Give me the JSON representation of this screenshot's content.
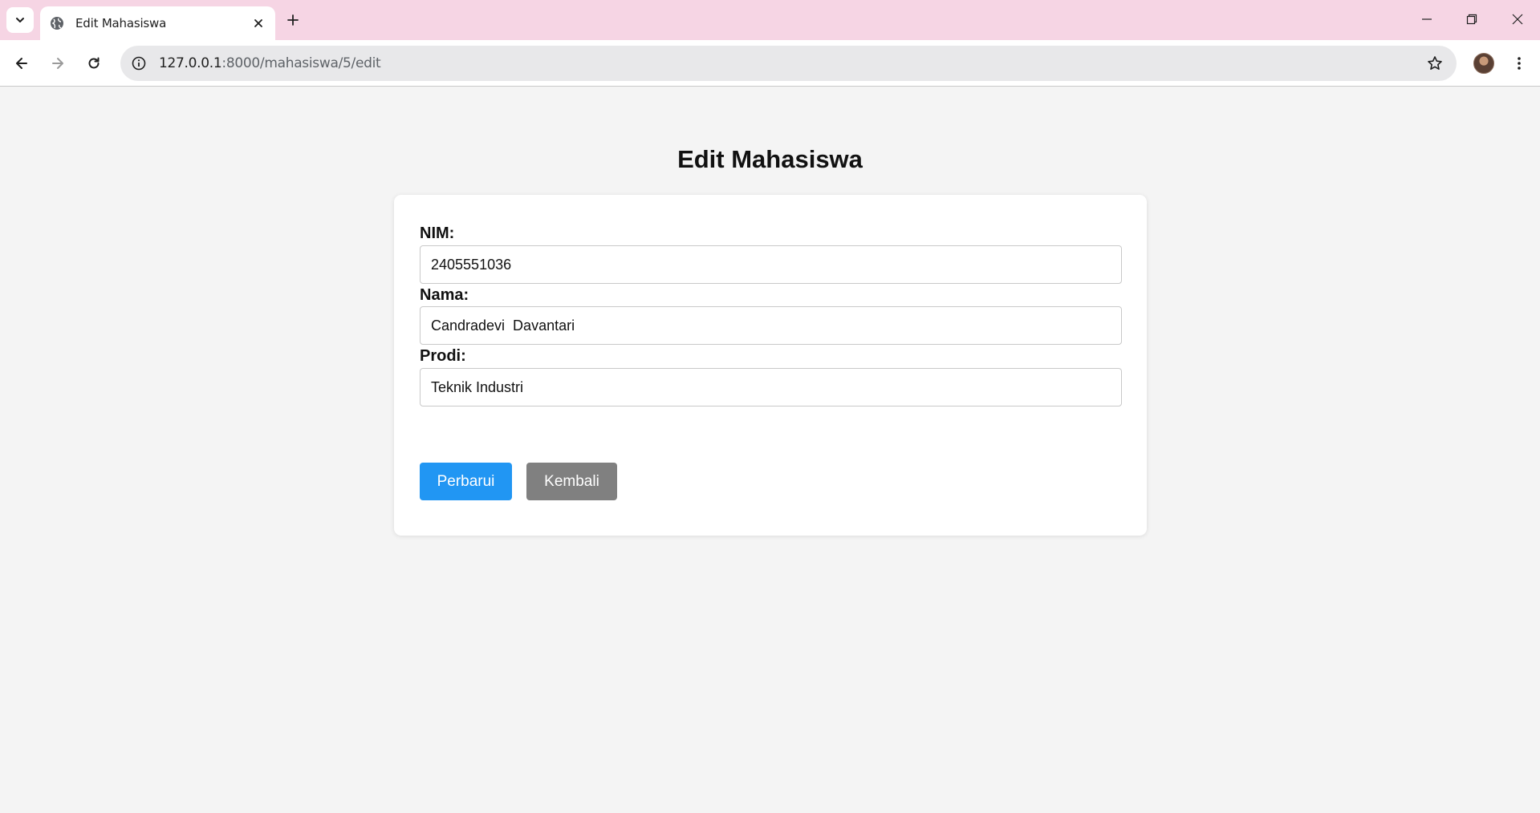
{
  "browser": {
    "tab_title": "Edit Mahasiswa",
    "url_host": "127.0.0.1",
    "url_path": ":8000/mahasiswa/5/edit"
  },
  "page": {
    "title": "Edit Mahasiswa"
  },
  "form": {
    "nim_label": "NIM:",
    "nim_value": "2405551036",
    "nama_label": "Nama:",
    "nama_value": "Candradevi  Davantari",
    "prodi_label": "Prodi:",
    "prodi_value": "Teknik Industri",
    "submit_label": "Perbarui",
    "back_label": "Kembali"
  },
  "colors": {
    "primary_button": "#2196f3",
    "secondary_button": "#808080",
    "tabstrip": "#f6d5e4"
  }
}
